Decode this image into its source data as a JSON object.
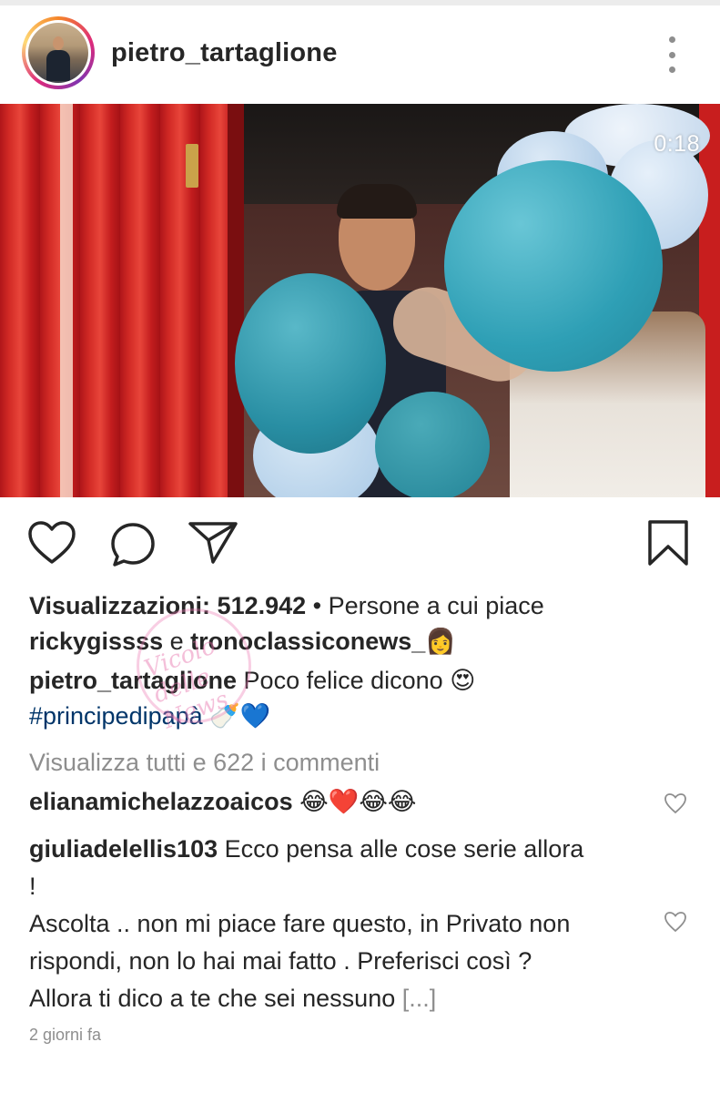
{
  "post": {
    "username": "pietro_tartaglione",
    "video_time": "0:18"
  },
  "stats": {
    "views_label": "Visualizzazioni: 512.942",
    "separator": " • ",
    "likes_prefix": "Persone a cui piace",
    "liker_one": "rickygissss",
    "likers_and": " e ",
    "liker_two": "tronoclassiconews_",
    "liker_two_emoji": "👩"
  },
  "caption": {
    "username": "pietro_tartaglione",
    "text": " Poco felice dicono ",
    "emoji": "😍",
    "hashtag": "#principedipapà",
    "hashtag_emoji": "🍼💙"
  },
  "comments": {
    "view_all": "Visualizza tutti e 622 i commenti",
    "items": [
      {
        "username": "elianamichelazzoaicos",
        "text": " ",
        "emoji": "😂❤️😂😂"
      },
      {
        "username": "giuliadelellis103",
        "text": " Ecco pensa alle cose serie allora !\nAscolta .. non mi piace fare questo, in Privato non rispondi, non lo hai mai fatto . Preferisci così ? Allora ti dico a  te che sei nessuno ",
        "more": "[...]"
      }
    ]
  },
  "time_ago": "2 giorni fa",
  "watermark": "Vicolo delle News",
  "icons": {
    "like": "heart-icon",
    "comment": "comment-icon",
    "share": "paper-plane-icon",
    "save": "bookmark-icon",
    "more": "more-vertical-icon",
    "comment_like": "small-heart-icon"
  },
  "colors": {
    "text": "#262626",
    "secondary": "#8e8e8e",
    "hashtag": "#003569"
  }
}
